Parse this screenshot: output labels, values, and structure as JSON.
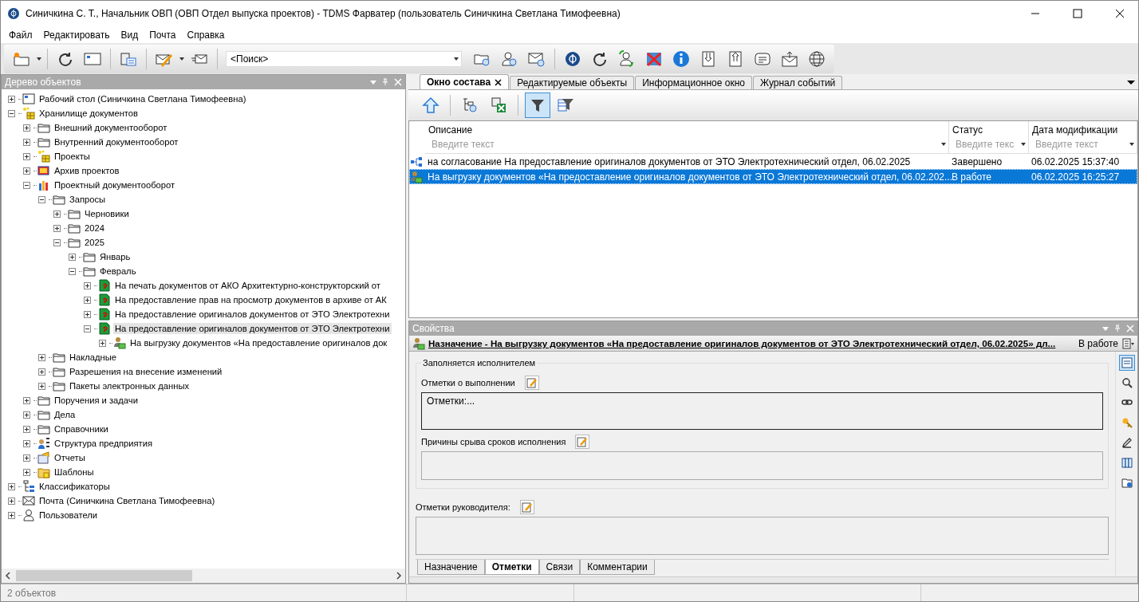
{
  "window": {
    "title": "Синичкина С. Т., Начальник ОВП (ОВП Отдел выпуска проектов) - TDMS Фарватер (пользователь Синичкина Светлана Тимофеевна)"
  },
  "menu": [
    "Файл",
    "Редактировать",
    "Вид",
    "Почта",
    "Справка"
  ],
  "search": {
    "value": "<Поиск>"
  },
  "tree_panel": {
    "title": "Дерево объектов",
    "items": [
      {
        "kind": "desktop",
        "label": "Рабочий стол (Синичкина Светлана Тимофеевна)",
        "expanded": false,
        "selected": false
      },
      {
        "kind": "storage",
        "label": "Хранилище документов",
        "expanded": true,
        "selected": false,
        "children": [
          {
            "kind": "folder",
            "label": "Внешний документооборот",
            "expanded": false,
            "selected": false
          },
          {
            "kind": "folder",
            "label": "Внутренний документооборот",
            "expanded": false,
            "selected": false
          },
          {
            "kind": "storage",
            "label": "Проекты",
            "expanded": false,
            "selected": false
          },
          {
            "kind": "archive",
            "label": "Архив проектов",
            "expanded": false,
            "selected": false
          },
          {
            "kind": "chart",
            "label": "Проектный документооборот",
            "expanded": true,
            "selected": false,
            "children": [
              {
                "kind": "folder",
                "label": "Запросы",
                "expanded": true,
                "selected": false,
                "children": [
                  {
                    "kind": "folder",
                    "label": "Черновики",
                    "expanded": false,
                    "selected": false
                  },
                  {
                    "kind": "folder",
                    "label": "2024",
                    "expanded": false,
                    "selected": false
                  },
                  {
                    "kind": "folder",
                    "label": "2025",
                    "expanded": true,
                    "selected": false,
                    "children": [
                      {
                        "kind": "folder",
                        "label": "Январь",
                        "expanded": false,
                        "selected": false
                      },
                      {
                        "kind": "folder",
                        "label": "Февраль",
                        "expanded": true,
                        "selected": false,
                        "children": [
                          {
                            "kind": "request",
                            "label": "На печать документов от АКО Архитектурно-конструкторский от",
                            "expanded": false,
                            "selected": false
                          },
                          {
                            "kind": "request",
                            "label": "На предоставление прав на просмотр документов в архиве от АК",
                            "expanded": false,
                            "selected": false
                          },
                          {
                            "kind": "request",
                            "label": "На предоставление оригиналов документов от ЭТО Электротехни",
                            "expanded": false,
                            "selected": false
                          },
                          {
                            "kind": "request",
                            "label": "На предоставление оригиналов документов от ЭТО Электротехни",
                            "expanded": true,
                            "selected": true,
                            "children": [
                              {
                                "kind": "assignment",
                                "label": "На выгрузку документов «На предоставление оригиналов док",
                                "expanded": false,
                                "selected": false
                              }
                            ]
                          }
                        ]
                      }
                    ]
                  }
                ]
              },
              {
                "kind": "folder",
                "label": "Накладные",
                "expanded": false,
                "selected": false
              },
              {
                "kind": "folder",
                "label": "Разрешения на внесение изменений",
                "expanded": false,
                "selected": false
              },
              {
                "kind": "folder",
                "label": "Пакеты электронных данных",
                "expanded": false,
                "selected": false
              }
            ]
          },
          {
            "kind": "folder",
            "label": "Поручения и задачи",
            "expanded": false,
            "selected": false
          },
          {
            "kind": "folder",
            "label": "Дела",
            "expanded": false,
            "selected": false
          },
          {
            "kind": "folder",
            "label": "Справочники",
            "expanded": false,
            "selected": false
          },
          {
            "kind": "org",
            "label": "Структура предприятия",
            "expanded": false,
            "selected": false
          },
          {
            "kind": "report",
            "label": "Отчеты",
            "expanded": false,
            "selected": false
          },
          {
            "kind": "template",
            "label": "Шаблоны",
            "expanded": false,
            "selected": false
          }
        ]
      },
      {
        "kind": "classifier",
        "label": "Классификаторы",
        "expanded": false,
        "selected": false
      },
      {
        "kind": "mail",
        "label": "Почта (Синичкина Светлана Тимофеевна)",
        "expanded": false,
        "selected": false
      },
      {
        "kind": "user",
        "label": "Пользователи",
        "expanded": false,
        "selected": false
      }
    ]
  },
  "tabs": [
    {
      "label": "Окно состава",
      "selected": true
    },
    {
      "label": "Редактируемые объекты",
      "selected": false
    },
    {
      "label": "Информационное окно",
      "selected": false
    },
    {
      "label": "Журнал событий",
      "selected": false
    }
  ],
  "content_toolbar": {
    "filter_on": true
  },
  "table": {
    "columns": [
      {
        "label": "Описание",
        "placeholder": "Введите текст"
      },
      {
        "label": "Статус",
        "placeholder": "Введите текс"
      },
      {
        "label": "Дата модификации",
        "placeholder": "Введите текст"
      }
    ],
    "rows": [
      {
        "kind": "route",
        "selected": false,
        "cells": [
          "на согласование На предоставление оригиналов документов от ЭТО Электротехнический отдел, 06.02.2025",
          "Завершено",
          "06.02.2025 15:37:40"
        ]
      },
      {
        "kind": "assignment",
        "selected": true,
        "cells": [
          "На выгрузку документов «На предоставление оригиналов документов от ЭТО Электротехнический отдел, 06.02.202...",
          "В работе",
          "06.02.2025 16:25:27"
        ]
      }
    ]
  },
  "properties": {
    "title": "Свойства",
    "header": {
      "text": "Назначение - На выгрузку документов «На предоставление оригиналов документов от ЭТО Электротехнический отдел, 06.02.2025» дл...",
      "status": "В работе"
    },
    "group": {
      "title": "Заполняется исполнителем",
      "fields": [
        {
          "label": "Отметки о выполнении",
          "value": "Отметки:...",
          "focused": true
        },
        {
          "label": "Причины срыва сроков исполнения",
          "focused": false
        }
      ]
    },
    "fields": [
      {
        "label": "Отметки руководителя:",
        "focused": false
      }
    ],
    "tabs": [
      {
        "label": "Назначение",
        "selected": false
      },
      {
        "label": "Отметки",
        "selected": true
      },
      {
        "label": "Связи",
        "selected": false
      },
      {
        "label": "Комментарии",
        "selected": false
      }
    ]
  },
  "status_bar": {
    "text": "2 объектов"
  }
}
